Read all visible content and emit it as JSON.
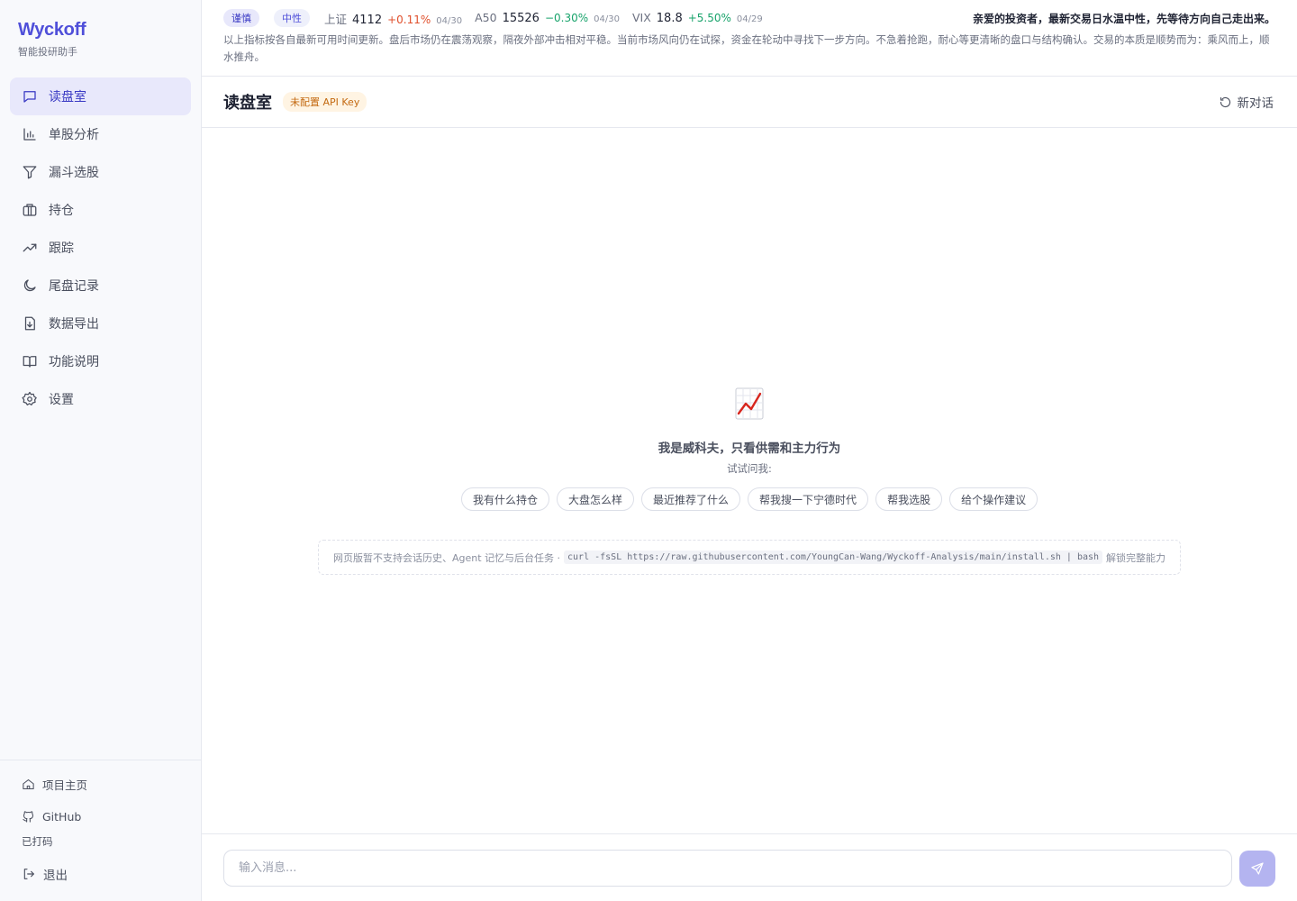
{
  "colors": {
    "accent": "#4f4fd9",
    "active_bg": "#e8e8fb",
    "up": "#e0502d",
    "down": "#18a36b",
    "warn": "#c46a12"
  },
  "sidebar": {
    "brand": "Wyckoff",
    "subtitle": "智能投研助手",
    "items": [
      {
        "label": "读盘室",
        "icon": "chat-icon",
        "active": true
      },
      {
        "label": "单股分析",
        "icon": "bar-chart-icon"
      },
      {
        "label": "漏斗选股",
        "icon": "funnel-icon"
      },
      {
        "label": "持仓",
        "icon": "briefcase-icon"
      },
      {
        "label": "跟踪",
        "icon": "trending-up-icon"
      },
      {
        "label": "尾盘记录",
        "icon": "moon-icon"
      },
      {
        "label": "数据导出",
        "icon": "file-download-icon"
      },
      {
        "label": "功能说明",
        "icon": "book-icon"
      },
      {
        "label": "设置",
        "icon": "gear-icon"
      }
    ],
    "bottom": {
      "home": "项目主页",
      "github": "GitHub",
      "user": "已打码",
      "logout": "退出"
    }
  },
  "ticker": {
    "mood": "谨慎",
    "temp": "中性",
    "indices": [
      {
        "name": "上证",
        "value": "4112",
        "change": "+0.11%",
        "date": "04/30",
        "dir": "up"
      },
      {
        "name": "A50",
        "value": "15526",
        "change": "−0.30%",
        "date": "04/30",
        "dir": "down"
      },
      {
        "name": "VIX",
        "value": "18.8",
        "change": "+5.50%",
        "date": "04/29",
        "dir": "up-g"
      }
    ],
    "greeting": "亲爱的投资者，最新交易日水温中性，先等待方向自己走出来。",
    "note": "以上指标按各自最新可用时间更新。盘后市场仍在震荡观察，隔夜外部冲击相对平稳。当前市场风向仍在试探，资金在轮动中寻找下一步方向。不急着抢跑，耐心等更清晰的盘口与结构确认。交易的本质是顺势而为：乘风而上，顺水推舟。"
  },
  "header": {
    "title": "读盘室",
    "badge": "未配置 API Key",
    "new_chat": "新对话"
  },
  "empty_state": {
    "headline": "我是威科夫，只看供需和主力行为",
    "try_label": "试试问我:",
    "suggestions": [
      "我有什么持仓",
      "大盘怎么样",
      "最近推荐了什么",
      "帮我搜一下宁德时代",
      "帮我选股",
      "给个操作建议"
    ],
    "notice_prefix": "网页版暂不支持会话历史、Agent 记忆与后台任务 ·",
    "notice_command": "curl -fsSL https://raw.githubusercontent.com/YoungCan-Wang/Wyckoff-Analysis/main/install.sh | bash",
    "notice_suffix": "解锁完整能力"
  },
  "composer": {
    "placeholder": "输入消息..."
  }
}
